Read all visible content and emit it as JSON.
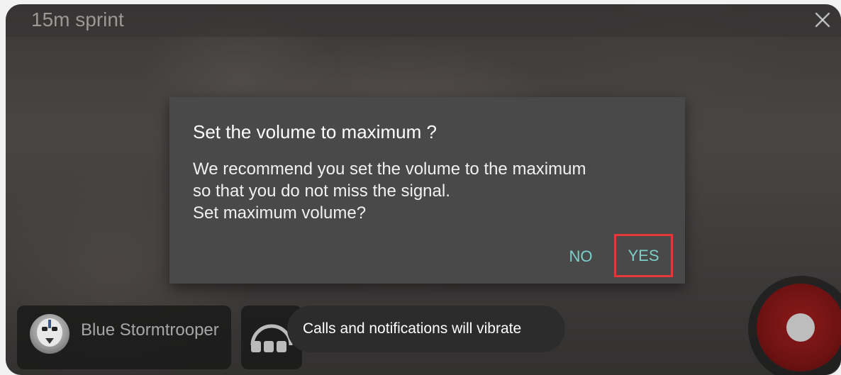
{
  "header": {
    "title": "15m sprint",
    "close_icon": "close-icon"
  },
  "dialog": {
    "title": "Set the volume to maximum ?",
    "body_lines": [
      "We recommend you set the volume to the maximum",
      "so that you do not miss the signal.",
      "Set maximum volume?"
    ],
    "no_label": "NO",
    "yes_label": "YES",
    "button_color": "#7ad0c8",
    "highlight_color": "#e53935"
  },
  "player": {
    "name": "Blue Stormtrooper",
    "avatar_icon": "stormtrooper-avatar"
  },
  "sound": {
    "icon": "headphones-icon"
  },
  "toast": {
    "text": "Calls and notifications will vibrate"
  },
  "record": {
    "icon": "record-icon",
    "color": "#8b1a1a"
  }
}
